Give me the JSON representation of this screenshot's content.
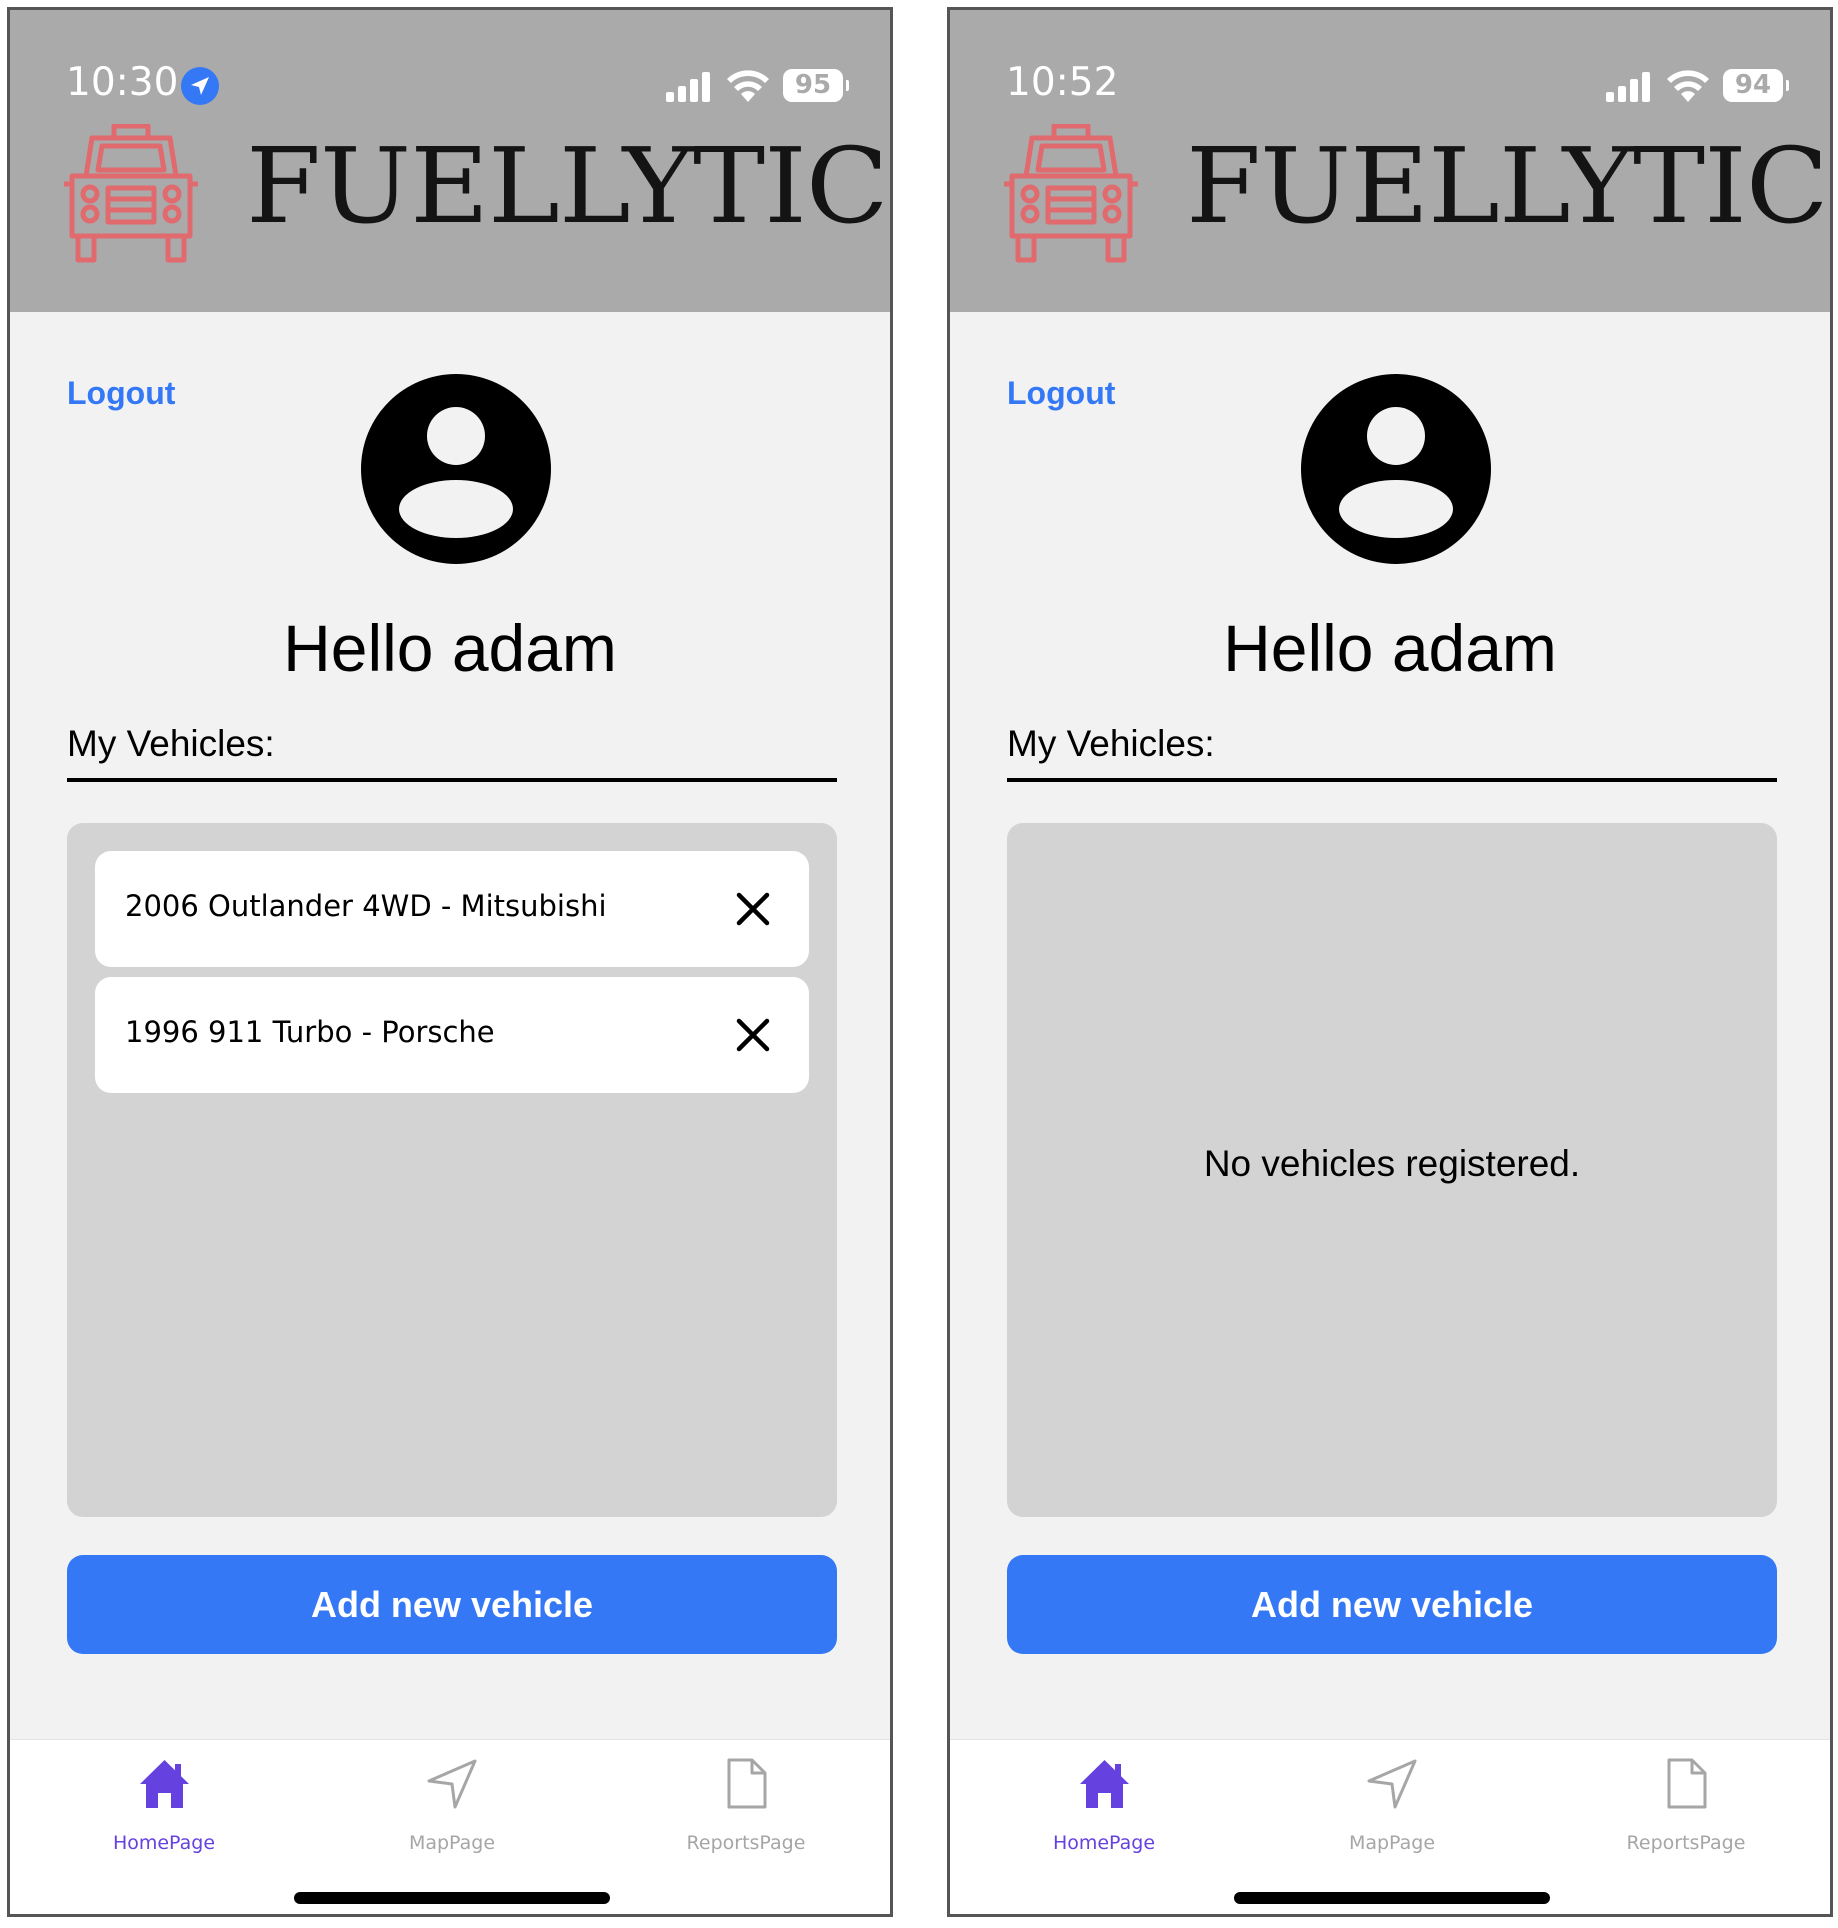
{
  "app": {
    "title": "FUELLYTICS",
    "colors": {
      "header": "#aaaaaa",
      "accent": "#3478f6",
      "logo": "#e06a6e",
      "tab_active": "#6541e0",
      "tab_inactive": "#a6a6a6"
    }
  },
  "screens": [
    {
      "status": {
        "time": "10:30",
        "battery": "95",
        "location_icon": "location-arrow-icon"
      },
      "logout_label": "Logout",
      "greeting": "Hello adam",
      "vehicles_label": "My Vehicles:",
      "vehicles": [
        {
          "name": "2006 Outlander 4WD - Mitsubishi"
        },
        {
          "name": "1996 911 Turbo - Porsche"
        }
      ],
      "empty_message": "",
      "add_button_label": "Add new vehicle",
      "tabs": [
        {
          "label": "HomePage",
          "icon": "home-icon",
          "active": true
        },
        {
          "label": "MapPage",
          "icon": "navigation-arrow-icon",
          "active": false
        },
        {
          "label": "ReportsPage",
          "icon": "document-icon",
          "active": false
        }
      ]
    },
    {
      "status": {
        "time": "10:52",
        "battery": "94"
      },
      "logout_label": "Logout",
      "greeting": "Hello adam",
      "vehicles_label": "My Vehicles:",
      "vehicles": [],
      "empty_message": "No vehicles registered.",
      "add_button_label": "Add new vehicle",
      "tabs": [
        {
          "label": "HomePage",
          "icon": "home-icon",
          "active": true
        },
        {
          "label": "MapPage",
          "icon": "navigation-arrow-icon",
          "active": false
        },
        {
          "label": "ReportsPage",
          "icon": "document-icon",
          "active": false
        }
      ]
    }
  ]
}
